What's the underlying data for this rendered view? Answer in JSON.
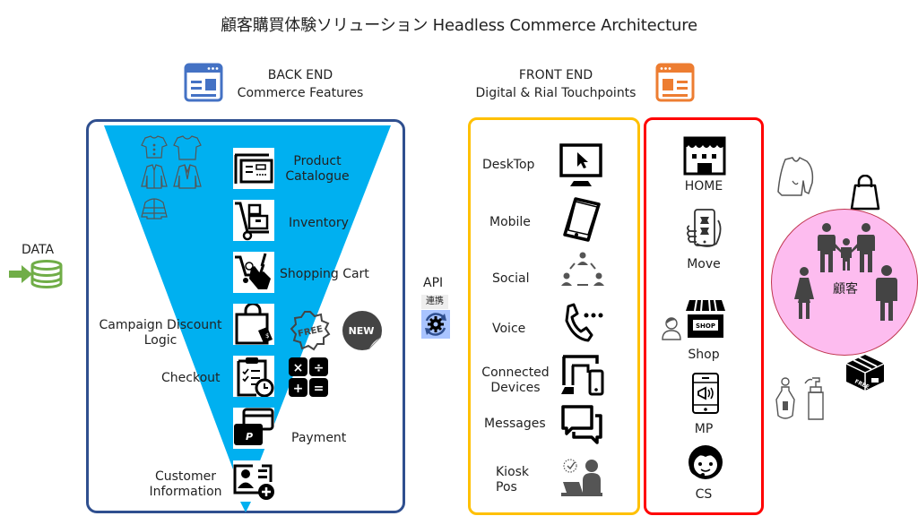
{
  "title": "顧客購買体験ソリューション  Headless Commerce Architecture",
  "colors": {
    "backend_border": "#2f4f8f",
    "funnel": "#00b0f0",
    "frontend_border": "#ffc000",
    "channel_border": "#ff0000",
    "data_green": "#70ad47",
    "customer_circle": "#fdbcef",
    "backend_header_icon": "#4472c4",
    "frontend_header_icon": "#ed7d31"
  },
  "backend": {
    "header_line1": "BACK END",
    "header_line2": "Commerce Features",
    "header_icon": "browser-window-icon",
    "features": [
      {
        "label_line1": "Product",
        "label_line2": "Catalogue",
        "icon": "catalogue-icon"
      },
      {
        "label_line1": "Inventory",
        "label_line2": "",
        "icon": "hand-truck-icon"
      },
      {
        "label_line1": "Shopping Cart",
        "label_line2": "",
        "icon": "cart-click-icon"
      },
      {
        "label_line1": "Campaign  Discount",
        "label_line2": "Logic",
        "icon": "bag-tag-icon"
      },
      {
        "label_line1": "Checkout",
        "label_line2": "",
        "icon": "checklist-clock-icon"
      },
      {
        "label_line1": "Payment",
        "label_line2": "",
        "icon": "payment-cards-icon"
      },
      {
        "label_line1": "Customer",
        "label_line2": "Information",
        "icon": "add-contact-icon"
      }
    ],
    "badges": {
      "free": "FREE",
      "new": "NEW"
    },
    "calculator_symbols": [
      "×",
      "÷",
      "+",
      "="
    ]
  },
  "data_source": {
    "label": "DATA",
    "icon": "database-import-icon"
  },
  "api": {
    "label": "API",
    "sublabel": "連携",
    "icon": "sync-gear-icon"
  },
  "frontend": {
    "header_line1": "FRONT END",
    "header_line2": "Digital & Rial Touchpoints",
    "header_icon": "browser-window-icon",
    "touchpoints": [
      {
        "label_line1": "DeskTop",
        "label_line2": "",
        "icon": "monitor-icon"
      },
      {
        "label_line1": "Mobile",
        "label_line2": "",
        "icon": "phone-icon"
      },
      {
        "label_line1": "Social",
        "label_line2": "",
        "icon": "social-network-icon"
      },
      {
        "label_line1": "Voice",
        "label_line2": "",
        "icon": "phone-call-icon"
      },
      {
        "label_line1": "Connected",
        "label_line2": "Devices",
        "icon": "devices-icon"
      },
      {
        "label_line1": "Messages",
        "label_line2": "",
        "icon": "chat-bubbles-icon"
      },
      {
        "label_line1": "Kiosk",
        "label_line2": "Pos",
        "icon": "kiosk-icon"
      }
    ]
  },
  "channels": [
    {
      "label": "HOME",
      "icon": "storefront-icon"
    },
    {
      "label": "Move",
      "icon": "hand-phone-icon"
    },
    {
      "label": "Shop",
      "icon": "shop-icon",
      "sign": "SHOP"
    },
    {
      "label": "MP",
      "icon": "phone-megaphone-icon"
    },
    {
      "label": "CS",
      "icon": "headset-agent-icon"
    }
  ],
  "customer": {
    "label": "顧客",
    "box_label": "FREE"
  }
}
